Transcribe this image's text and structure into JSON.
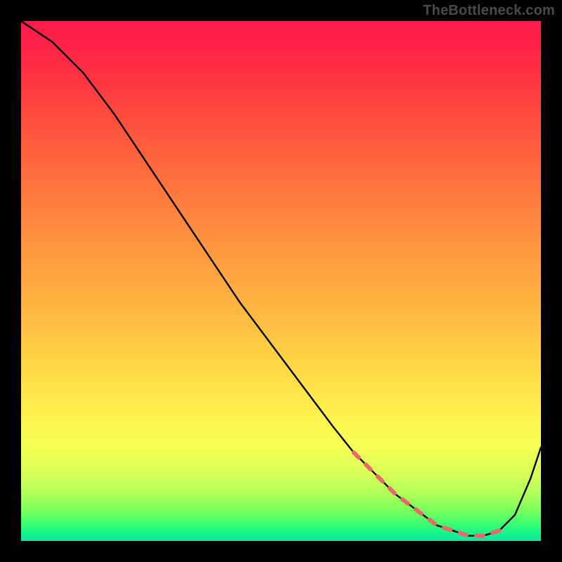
{
  "watermark": "TheBottleneck.com",
  "chart_data": {
    "type": "line",
    "title": "",
    "xlabel": "",
    "ylabel": "",
    "xlim": [
      0,
      100
    ],
    "ylim": [
      0,
      100
    ],
    "x": [
      0,
      6,
      12,
      18,
      24,
      30,
      36,
      42,
      48,
      54,
      60,
      64,
      68,
      72,
      76,
      80,
      83,
      86,
      89,
      92,
      95,
      98,
      100
    ],
    "y": [
      100,
      96,
      90,
      82,
      73,
      64,
      55,
      46,
      38,
      30,
      22,
      17,
      13,
      9,
      6,
      3,
      2,
      1,
      1,
      2,
      5,
      12,
      18
    ],
    "gradient_stops": [
      {
        "pos": 0.0,
        "color": "#ff1b4b"
      },
      {
        "pos": 0.08,
        "color": "#ff2a44"
      },
      {
        "pos": 0.18,
        "color": "#ff4b3f"
      },
      {
        "pos": 0.3,
        "color": "#ff6f3d"
      },
      {
        "pos": 0.42,
        "color": "#ff923e"
      },
      {
        "pos": 0.55,
        "color": "#ffb541"
      },
      {
        "pos": 0.67,
        "color": "#ffd946"
      },
      {
        "pos": 0.76,
        "color": "#fff24e"
      },
      {
        "pos": 0.82,
        "color": "#f6ff55"
      },
      {
        "pos": 0.87,
        "color": "#d8ff57"
      },
      {
        "pos": 0.91,
        "color": "#afff59"
      },
      {
        "pos": 0.94,
        "color": "#7cff5c"
      },
      {
        "pos": 0.965,
        "color": "#40ff6e"
      },
      {
        "pos": 0.985,
        "color": "#17f58c"
      },
      {
        "pos": 1.0,
        "color": "#0be6a0"
      }
    ],
    "dash_region": {
      "x": [
        64,
        68,
        72,
        76,
        80,
        83,
        86,
        89,
        92
      ],
      "y": [
        17,
        13,
        9,
        6,
        3,
        2,
        1,
        1,
        2
      ]
    },
    "dash_color": "#e76a6a"
  }
}
